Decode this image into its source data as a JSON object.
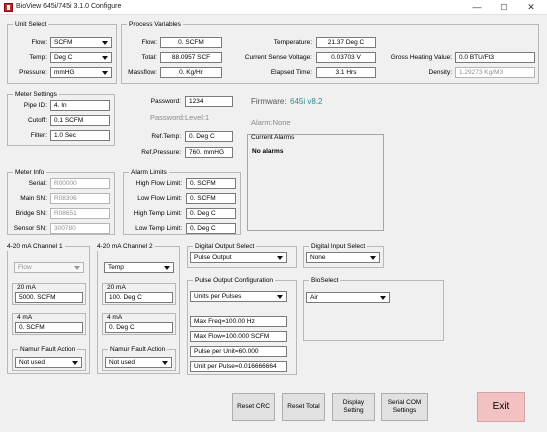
{
  "window": {
    "title": "BioView 645i/745i 3.1.0 Configure",
    "minimize": "—",
    "maximize": "☐",
    "close": "✕"
  },
  "unit_select": {
    "title": "Unit Select",
    "flow_label": "Flow:",
    "flow_value": "SCFM",
    "temp_label": "Temp:",
    "temp_value": "Deg C",
    "pressure_label": "Pressure:",
    "pressure_value": "mmHG"
  },
  "process_variables": {
    "title": "Process Variables",
    "flow_label": "Flow:",
    "flow_value": "0. SCFM",
    "total_label": "Total:",
    "total_value": "88.0957 SCF",
    "massflow_label": "Massflow:",
    "massflow_value": "0. Kg/Hr",
    "temperature_label": "Temperature:",
    "temperature_value": "21.37 Deg C",
    "sense_voltage_label": "Current Sense Voltage:",
    "sense_voltage_value": "0.03703 V",
    "elapsed_label": "Elapsed Time:",
    "elapsed_value": "3.1  Hrs",
    "gross_heating_label": "Gross Heating Value:",
    "gross_heating_value": "0.0 BTU/Ft3",
    "density_label": "Density:",
    "density_value": "1.29273 Kg/M3"
  },
  "meter_settings": {
    "title": "Meter Settings",
    "pipe_id_label": "Pipe ID:",
    "pipe_id_value": "4. In",
    "cutoff_label": "Cutoff:",
    "cutoff_value": "0.1 SCFM",
    "filter_label": "Filter:",
    "filter_value": "1.0 Sec"
  },
  "security": {
    "password_label": "Password:",
    "password_value": "1234",
    "level_text": "Password:Level:1",
    "ref_temp_label": "Ref.Temp:",
    "ref_temp_value": "0. Deg C",
    "ref_pressure_label": "Ref.Pressure:",
    "ref_pressure_value": "760. mmHG"
  },
  "firmware": {
    "label": "Firmware:",
    "version": "645i v8.2"
  },
  "alarm": {
    "status_text": "Alarm:None",
    "current_title": "Current Alarms",
    "current_text": "No alarms"
  },
  "meter_info": {
    "title": "Meter Info",
    "serial_label": "Serial:",
    "serial_value": "R00000",
    "main_sn_label": "Main SN:",
    "main_sn_value": "R08306",
    "bridge_sn_label": "Bridge SN:",
    "bridge_sn_value": "R08651",
    "sensor_sn_label": "Sensor SN:",
    "sensor_sn_value": "300780"
  },
  "alarm_limits": {
    "title": "Alarm Limits",
    "high_flow_label": "High Flow Limit:",
    "high_flow_value": "0. SCFM",
    "low_flow_label": "Low Flow Limit:",
    "low_flow_value": "0. SCFM",
    "high_temp_label": "High Temp Limit:",
    "high_temp_value": "0. Deg C",
    "low_temp_label": "Low Temp Limit:",
    "low_temp_value": "0. Deg C"
  },
  "channel1": {
    "title": "4-20 mA Channel 1",
    "source": "Flow",
    "ma20_label": "20 mA",
    "ma20_value": "5000. SCFM",
    "ma4_label": "4 mA",
    "ma4_value": "0. SCFM",
    "namur_label": "Namur Fault Action",
    "namur_value": "Not used"
  },
  "channel2": {
    "title": "4-20 mA Channel 2",
    "source": "Temp",
    "ma20_label": "20 mA",
    "ma20_value": "100. Deg C",
    "ma4_label": "4 mA",
    "ma4_value": "0. Deg C",
    "namur_label": "Namur Fault Action",
    "namur_value": "Not used"
  },
  "digital_output": {
    "title": "Digital Output Select",
    "value": "Pulse Output"
  },
  "digital_input": {
    "title": "Digital Input Select",
    "value": "None"
  },
  "pulse_output": {
    "title": "Pulse Output Configuration",
    "mode": "Units per Pulses",
    "max_freq": "Max Freq=100.00 Hz",
    "max_flow": "Max Flow=100.000 SCFM",
    "pulse_per_unit": "Pulse per Unit=60.000",
    "unit_per_pulse": "Unit per Pulse=0.016666664"
  },
  "bioselect": {
    "title": "BioSelect",
    "value": "Air"
  },
  "buttons": {
    "reset_crc": "Reset CRC",
    "reset_total": "Reset Total",
    "display_setting": "Display Setting",
    "serial_com": "Serial COM Settings",
    "exit": "Exit"
  },
  "colors": {
    "firmware_accent": "#2e8b8b",
    "exit_button": "#f2c1c1"
  }
}
